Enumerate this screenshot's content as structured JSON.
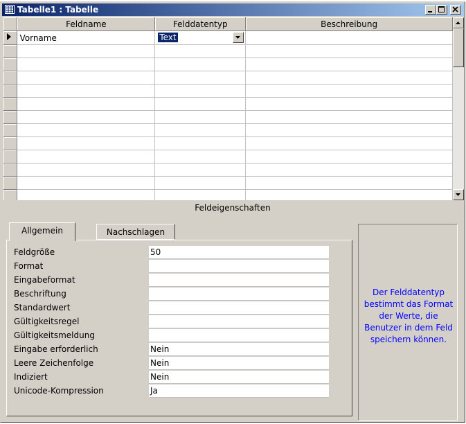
{
  "window": {
    "title": "Tabelle1 : Tabelle",
    "icon": "table-icon",
    "buttons": [
      "minimize",
      "maximize",
      "close"
    ]
  },
  "grid": {
    "headers": [
      "Feldname",
      "Felddatentyp",
      "Beschreibung"
    ],
    "rows": [
      {
        "name": "Vorname",
        "type": "Text",
        "description": ""
      }
    ],
    "empty_rows": 10
  },
  "properties": {
    "title": "Feldeigenschaften",
    "tabs": [
      "Allgemein",
      "Nachschlagen"
    ],
    "active_tab": "Allgemein",
    "fields": [
      {
        "label": "Feldgröße",
        "value": "50"
      },
      {
        "label": "Format",
        "value": ""
      },
      {
        "label": "Eingabeformat",
        "value": ""
      },
      {
        "label": "Beschriftung",
        "value": ""
      },
      {
        "label": "Standardwert",
        "value": ""
      },
      {
        "label": "Gültigkeitsregel",
        "value": ""
      },
      {
        "label": "Gültigkeitsmeldung",
        "value": ""
      },
      {
        "label": "Eingabe erforderlich",
        "value": "Nein"
      },
      {
        "label": "Leere Zeichenfolge",
        "value": "Nein"
      },
      {
        "label": "Indiziert",
        "value": "Nein"
      },
      {
        "label": "Unicode-Kompression",
        "value": "Ja"
      }
    ]
  },
  "help": {
    "text": "Der Felddatentyp bestimmt das Format der Werte, die Benutzer in dem Feld speichern können.",
    "color": "#0000ff"
  },
  "colors": {
    "title_start": "#0a246a",
    "title_end": "#a6caf0",
    "face": "#d4d0c8",
    "selection": "#0a246a"
  }
}
